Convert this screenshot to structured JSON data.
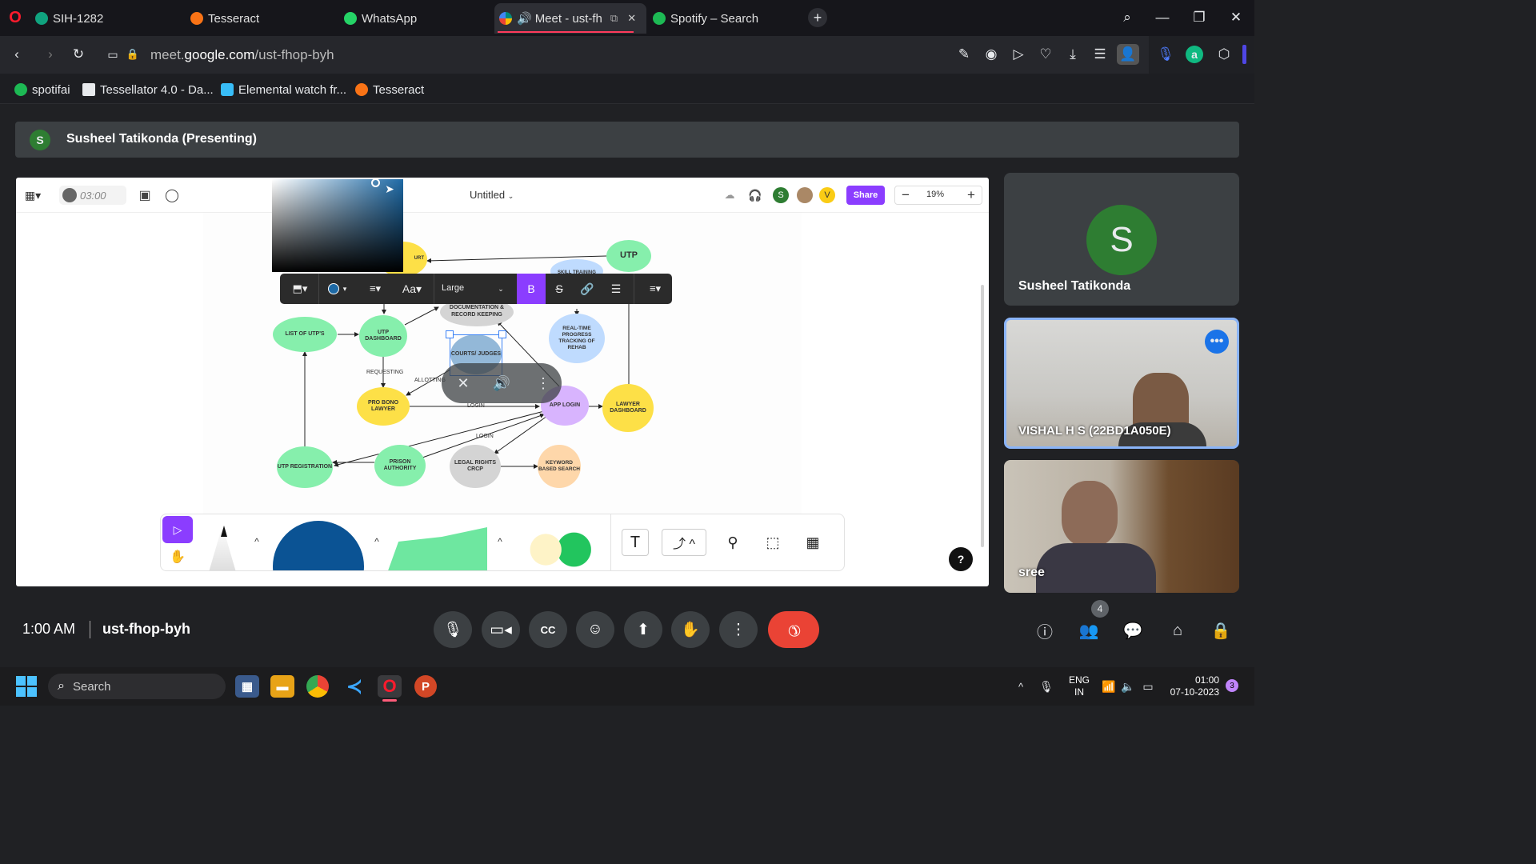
{
  "browser": {
    "tabs": [
      {
        "label": "SIH-1282",
        "color": "#10a37f"
      },
      {
        "label": "Tesseract",
        "color": "#f97316"
      },
      {
        "label": "WhatsApp",
        "color": "#25d366"
      },
      {
        "label": "Meet - ust-fh",
        "color": "#00897b"
      },
      {
        "label": "Spotify – Search",
        "color": "#1db954"
      }
    ],
    "url_prefix": "meet.",
    "url_domain": "google.com",
    "url_path": "/ust-fhop-byh",
    "bookmarks": [
      {
        "label": "spotifai",
        "color": "#1db954"
      },
      {
        "label": "Tessellator 4.0 - Da...",
        "color": "#e8eaed"
      },
      {
        "label": "Elemental watch fr...",
        "color": "#38bdf8"
      },
      {
        "label": "Tesseract",
        "color": "#f97316"
      }
    ]
  },
  "meet": {
    "presenter_initial": "S",
    "presenter_label": "Susheel Tatikonda (Presenting)",
    "time": "1:00 AM",
    "code": "ust-fhop-byh",
    "people_count": "4",
    "end_call_color": "#ea4335"
  },
  "board": {
    "timer": "03:00",
    "title": "Untitled",
    "share_label": "Share",
    "zoom": "19%",
    "text_size": "Large",
    "bold_label": "B",
    "avatar_s": "S",
    "avatar_v": "V",
    "help": "?",
    "text_tool": "T"
  },
  "diagram": {
    "nodes": [
      {
        "label": "UTP",
        "color": "#86efac"
      },
      {
        "label": "SKILL TRAINING",
        "color": "#bfdbfe"
      },
      {
        "label": "URT",
        "color": "#fde047"
      },
      {
        "label": "DOCUMENTATION & RECORD KEEPING",
        "color": "#d4d4d4"
      },
      {
        "label": "LIST OF UTP'S",
        "color": "#86efac"
      },
      {
        "label": "UTP DASHBOARD",
        "color": "#86efac"
      },
      {
        "label": "COURTS/ JUDGES",
        "color": "#93b8d8"
      },
      {
        "label": "REAL-TIME PROGRESS TRACKING OF REHAB",
        "color": "#bfdbfe"
      },
      {
        "label": "PRO BONO LAWYER",
        "color": "#fde047"
      },
      {
        "label": "APP LOGIN",
        "color": "#d8b4fe"
      },
      {
        "label": "LAWYER DASHBOARD",
        "color": "#fde047"
      },
      {
        "label": "UTP REGISTRATION",
        "color": "#86efac"
      },
      {
        "label": "PRISON AUTHORITY",
        "color": "#86efac"
      },
      {
        "label": "LEGAL RIGHTS CRCP",
        "color": "#d4d4d4"
      },
      {
        "label": "KEYWORD BASED SEARCH",
        "color": "#fed7aa"
      }
    ],
    "edge_labels": [
      "REQUESTING",
      "ALLOTTING",
      "LOGIN",
      "LOGIN"
    ]
  },
  "participants": [
    {
      "name": "Susheel Tatikonda",
      "initial": "S",
      "avatar_color": "#2e7d32"
    },
    {
      "name": "VISHAL H S (22BD1A050E)"
    },
    {
      "name": "sree"
    }
  ],
  "taskbar": {
    "search_placeholder": "Search",
    "lang_1": "ENG",
    "lang_2": "IN",
    "clock_time": "01:00",
    "clock_date": "07-10-2023",
    "notif_count": "3"
  }
}
